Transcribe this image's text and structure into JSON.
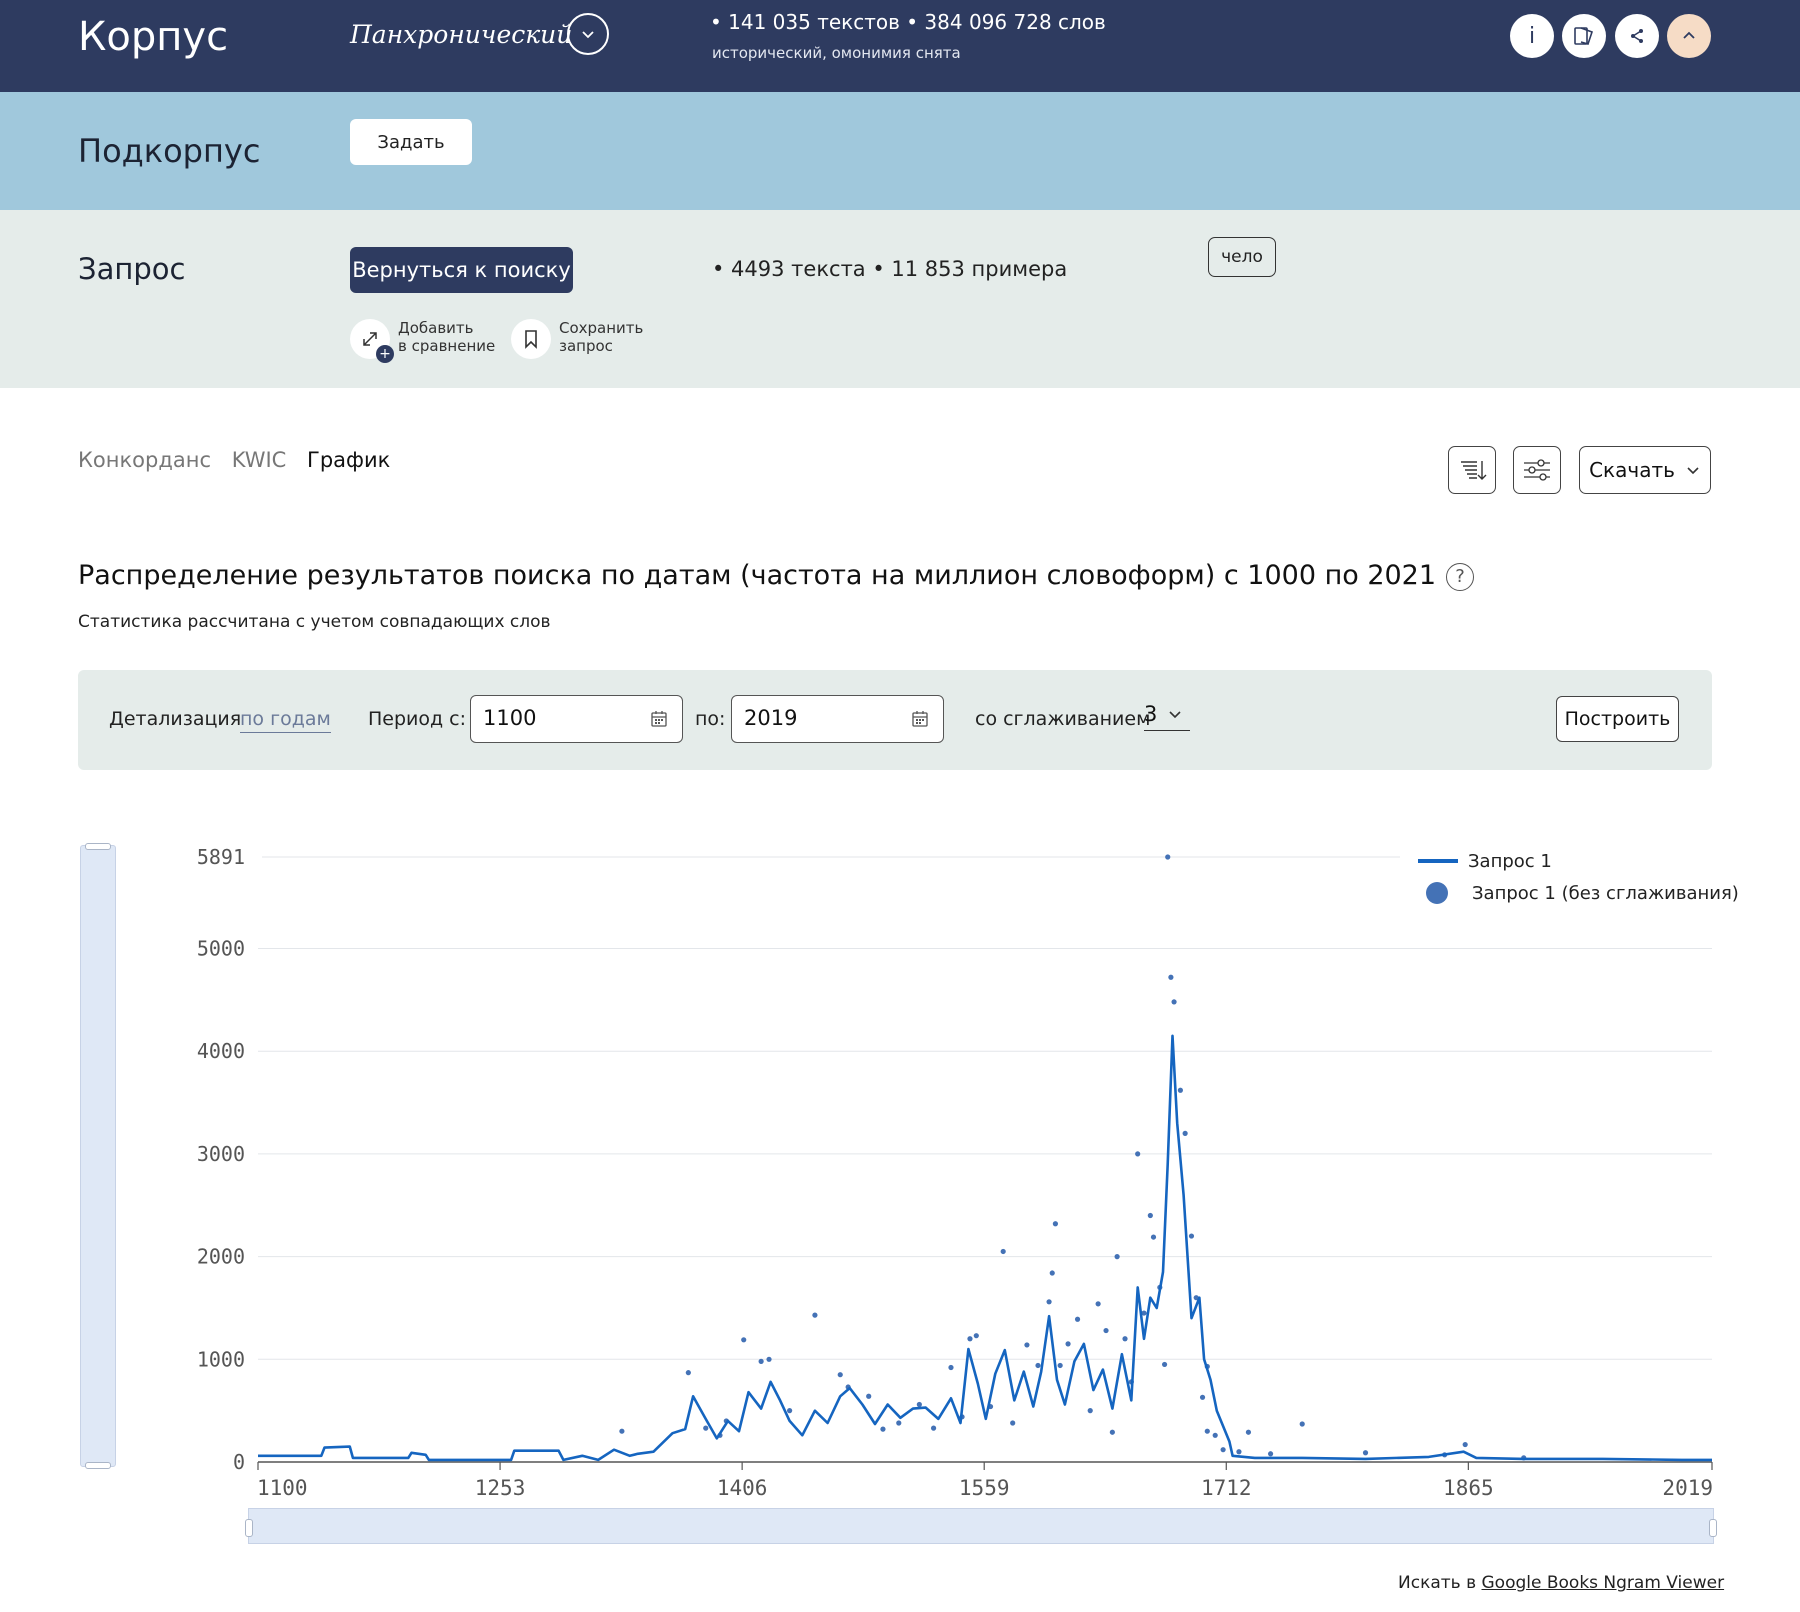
{
  "header": {
    "brand": "Корпус",
    "corpus_type": "Панхронический",
    "stats": "•  141 035 текстов •  384 096 728 слов",
    "stats_sub": "исторический, омонимия снята",
    "tools": [
      "info-icon",
      "docs-icon",
      "share-icon",
      "collapse-icon"
    ]
  },
  "subcorpus": {
    "label": "Подкорпус",
    "set_button": "Задать"
  },
  "query": {
    "label": "Запрос",
    "back_button": "Вернуться к поиску",
    "stats": "•  4493 текста •  11 853 примера",
    "chip": "чело",
    "add_compare_line1": "Добавить",
    "add_compare_line2": "в сравнение",
    "save_line1": "Сохранить",
    "save_line2": "запрос"
  },
  "tabs": {
    "concordance": "Конкорданс",
    "kwic": "KWIC",
    "graph": "График",
    "active": "График"
  },
  "toolbar": {
    "download": "Скачать"
  },
  "chart_header": {
    "title": "Распределение результатов поиска по датам (частота на миллион словоформ) с 1000 по 2021",
    "subtitle": "Статистика рассчитана с учетом совпадающих слов"
  },
  "controls": {
    "detail_label": "Детализация",
    "detail_value": "по годам",
    "period_label": "Период  с:",
    "from_value": "1100",
    "to_label": "по:",
    "to_value": "2019",
    "smoothing_label": "со сглаживанием",
    "smoothing_value": "3",
    "build_button": "Построить"
  },
  "chart_data": {
    "type": "line",
    "x_ticks": [
      "1100",
      "1253",
      "1406",
      "1559",
      "1712",
      "1865",
      "2019"
    ],
    "y_ticks": [
      "0",
      "1000",
      "2000",
      "3000",
      "4000",
      "5000",
      "5891"
    ],
    "xlim": [
      1100,
      2019
    ],
    "ylim": [
      0,
      5891
    ],
    "grid": true,
    "legend_position": "top-right",
    "series": [
      {
        "name": "Запрос 1",
        "style": "line",
        "color": "#1565c0",
        "points": [
          [
            1100,
            60
          ],
          [
            1140,
            60
          ],
          [
            1142,
            140
          ],
          [
            1158,
            150
          ],
          [
            1160,
            40
          ],
          [
            1195,
            40
          ],
          [
            1197,
            90
          ],
          [
            1206,
            70
          ],
          [
            1208,
            20
          ],
          [
            1260,
            20
          ],
          [
            1262,
            110
          ],
          [
            1290,
            110
          ],
          [
            1293,
            20
          ],
          [
            1305,
            60
          ],
          [
            1315,
            20
          ],
          [
            1325,
            120
          ],
          [
            1335,
            60
          ],
          [
            1340,
            80
          ],
          [
            1350,
            100
          ],
          [
            1362,
            280
          ],
          [
            1370,
            320
          ],
          [
            1375,
            640
          ],
          [
            1383,
            420
          ],
          [
            1390,
            230
          ],
          [
            1397,
            400
          ],
          [
            1404,
            300
          ],
          [
            1410,
            680
          ],
          [
            1418,
            520
          ],
          [
            1424,
            780
          ],
          [
            1430,
            600
          ],
          [
            1436,
            400
          ],
          [
            1444,
            260
          ],
          [
            1452,
            500
          ],
          [
            1460,
            380
          ],
          [
            1468,
            640
          ],
          [
            1474,
            720
          ],
          [
            1482,
            560
          ],
          [
            1490,
            370
          ],
          [
            1498,
            560
          ],
          [
            1506,
            430
          ],
          [
            1514,
            520
          ],
          [
            1522,
            530
          ],
          [
            1530,
            420
          ],
          [
            1538,
            620
          ],
          [
            1544,
            380
          ],
          [
            1549,
            1100
          ],
          [
            1555,
            760
          ],
          [
            1560,
            420
          ],
          [
            1566,
            860
          ],
          [
            1572,
            1090
          ],
          [
            1578,
            600
          ],
          [
            1584,
            880
          ],
          [
            1590,
            540
          ],
          [
            1595,
            880
          ],
          [
            1600,
            1420
          ],
          [
            1605,
            800
          ],
          [
            1610,
            560
          ],
          [
            1616,
            980
          ],
          [
            1622,
            1150
          ],
          [
            1628,
            700
          ],
          [
            1634,
            900
          ],
          [
            1640,
            520
          ],
          [
            1646,
            1050
          ],
          [
            1652,
            600
          ],
          [
            1656,
            1700
          ],
          [
            1660,
            1200
          ],
          [
            1664,
            1600
          ],
          [
            1668,
            1500
          ],
          [
            1672,
            1850
          ],
          [
            1675,
            2900
          ],
          [
            1678,
            4150
          ],
          [
            1681,
            3300
          ],
          [
            1685,
            2600
          ],
          [
            1690,
            1400
          ],
          [
            1695,
            1600
          ],
          [
            1698,
            1000
          ],
          [
            1702,
            800
          ],
          [
            1706,
            500
          ],
          [
            1710,
            350
          ],
          [
            1714,
            200
          ],
          [
            1716,
            60
          ],
          [
            1730,
            40
          ],
          [
            1760,
            40
          ],
          [
            1800,
            30
          ],
          [
            1840,
            50
          ],
          [
            1862,
            100
          ],
          [
            1870,
            40
          ],
          [
            1900,
            30
          ],
          [
            1950,
            30
          ],
          [
            2000,
            20
          ],
          [
            2019,
            20
          ]
        ]
      },
      {
        "name": "Запрос 1 (без сглаживания)",
        "style": "dots",
        "color": "#4472b6",
        "points": [
          [
            1330,
            300
          ],
          [
            1372,
            870
          ],
          [
            1383,
            330
          ],
          [
            1392,
            260
          ],
          [
            1396,
            400
          ],
          [
            1407,
            1190
          ],
          [
            1418,
            980
          ],
          [
            1423,
            1000
          ],
          [
            1436,
            500
          ],
          [
            1452,
            1430
          ],
          [
            1468,
            850
          ],
          [
            1473,
            730
          ],
          [
            1486,
            640
          ],
          [
            1495,
            320
          ],
          [
            1505,
            380
          ],
          [
            1518,
            560
          ],
          [
            1527,
            330
          ],
          [
            1538,
            920
          ],
          [
            1545,
            440
          ],
          [
            1550,
            1200
          ],
          [
            1554,
            1230
          ],
          [
            1563,
            540
          ],
          [
            1571,
            2050
          ],
          [
            1577,
            380
          ],
          [
            1586,
            1140
          ],
          [
            1593,
            940
          ],
          [
            1600,
            1560
          ],
          [
            1602,
            1840
          ],
          [
            1604,
            2320
          ],
          [
            1607,
            940
          ],
          [
            1612,
            1150
          ],
          [
            1618,
            1390
          ],
          [
            1626,
            500
          ],
          [
            1631,
            1540
          ],
          [
            1636,
            1280
          ],
          [
            1640,
            290
          ],
          [
            1643,
            2000
          ],
          [
            1648,
            1200
          ],
          [
            1652,
            780
          ],
          [
            1656,
            3000
          ],
          [
            1660,
            1450
          ],
          [
            1664,
            2400
          ],
          [
            1666,
            2190
          ],
          [
            1670,
            1700
          ],
          [
            1673,
            950
          ],
          [
            1675,
            5891
          ],
          [
            1677,
            4720
          ],
          [
            1679,
            4480
          ],
          [
            1683,
            3620
          ],
          [
            1686,
            3200
          ],
          [
            1690,
            2200
          ],
          [
            1693,
            1600
          ],
          [
            1697,
            630
          ],
          [
            1700,
            930
          ],
          [
            1705,
            260
          ],
          [
            1726,
            290
          ],
          [
            1760,
            370
          ],
          [
            1863,
            170
          ],
          [
            1700,
            300
          ],
          [
            1710,
            120
          ],
          [
            1720,
            100
          ],
          [
            1740,
            80
          ],
          [
            1800,
            90
          ],
          [
            1850,
            70
          ],
          [
            1900,
            40
          ]
        ]
      }
    ]
  },
  "footer": {
    "ngram_prefix": "Искать в",
    "ngram_link": "Google Books Ngram Viewer"
  }
}
